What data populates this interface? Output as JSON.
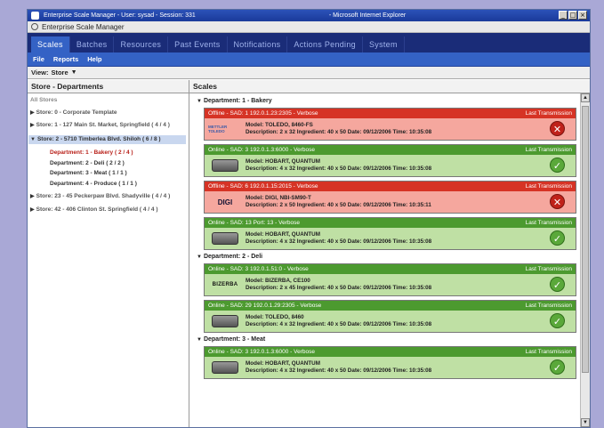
{
  "window": {
    "ie_title": "Enterprise Scale Manager - User: sysad - Session: 331",
    "browser_name": "- Microsoft Internet Explorer",
    "controls": [
      "_",
      "□",
      "×"
    ]
  },
  "app": {
    "title": "Enterprise Scale Manager"
  },
  "tabs": [
    "Scales",
    "Batches",
    "Resources",
    "Past Events",
    "Notifications",
    "Actions Pending",
    "System"
  ],
  "submenu": [
    "File",
    "Reports",
    "Help"
  ],
  "view": {
    "label": "View:",
    "value": "Store"
  },
  "left_pane": {
    "title": "Store - Departments",
    "all_stores": "All Stores",
    "stores": [
      {
        "label": "Store: 0 - Corporate Template"
      },
      {
        "label": "Store: 1 - 127 Main St. Market, Springfield ( 4 / 4 )"
      },
      {
        "label": "Store: 2 - 5710 Timberlea Blvd. Shiloh ( 6 / 8 )"
      },
      {
        "label": "Store: 23 - 45 Peckerpaw Blvd. Shadyville ( 4 / 4 )"
      },
      {
        "label": "Store: 42 - 406 Clinton St. Springfield ( 4 / 4 )"
      }
    ],
    "departments": [
      "Department: 1 - Bakery ( 2 / 4 )",
      "Department: 2 - Deli ( 2 / 2 )",
      "Department: 3 - Meat ( 1 / 1 )",
      "Department: 4 - Produce ( 1 / 1 )"
    ]
  },
  "right_pane": {
    "title": "Scales",
    "last_transmission": "Last Transmission",
    "departments": [
      {
        "label": "Department: 1 - Bakery",
        "scales": [
          {
            "status": "offline",
            "head": "Offline - SAD: 1 192.0.1.23:2305 - Verbose",
            "brand": "METTLER TOLEDO",
            "model": "Model: TOLEDO, 8460-FS",
            "desc": "Description: 2 x 32    Ingredient: 40 x 50    Date: 09/12/2006 Time: 10:35:08"
          },
          {
            "status": "online",
            "head": "Online - SAD: 3 192.0.1.3:6000 - Verbose",
            "brand": "",
            "model": "Model: HOBART, QUANTUM",
            "desc": "Description: 4 x 32    Ingredient: 40 x 50    Date: 09/12/2006 Time: 10:35:08"
          },
          {
            "status": "offline",
            "head": "Offline - SAD: 6 192.0.1.15:2015 - Verbose",
            "brand": "DIGI",
            "model": "Model: DIGI, NBI-SM90-T",
            "desc": "Description: 2 x 50    Ingredient: 40 x 50    Date: 09/12/2006 Time: 10:35:11"
          },
          {
            "status": "online",
            "head": "Online - SAD: 13 Port: 13 - Verbose",
            "brand": "",
            "model": "Model: HOBART, QUANTUM",
            "desc": "Description: 4 x 32    Ingredient: 40 x 50    Date: 09/12/2006 Time: 10:35:08"
          }
        ]
      },
      {
        "label": "Department: 2 - Deli",
        "scales": [
          {
            "status": "online",
            "head": "Online - SAD: 3 192.0.1.51:0 - Verbose",
            "brand": "BIZERBA",
            "model": "Model: BIZERBA, CE100",
            "desc": "Description: 2 x 45    Ingredient: 40 x 50    Date: 09/12/2006 Time: 10:35:08"
          },
          {
            "status": "online",
            "head": "Online - SAD: 29 192.0.1.29:2305 - Verbose",
            "brand": "",
            "model": "Model: TOLEDO, 8460",
            "desc": "Description: 4 x 32    Ingredient: 40 x 50    Date: 09/12/2006 Time: 10:35:08"
          }
        ]
      },
      {
        "label": "Department: 3 - Meat",
        "scales": [
          {
            "status": "online",
            "head": "Online - SAD: 3 192.0.1.3:6000 - Verbose",
            "brand": "",
            "model": "Model: HOBART, QUANTUM",
            "desc": "Description: 4 x 32    Ingredient: 40 x 50    Date: 09/12/2006 Time: 10:35:08"
          }
        ]
      }
    ]
  },
  "colors": {
    "offline_head": "#d63325",
    "offline_body": "#f5a79e",
    "online_head": "#4c9a2f",
    "online_body": "#bfe0a4",
    "tab_bar": "#1a2c78",
    "active_tab": "#3462c5"
  }
}
